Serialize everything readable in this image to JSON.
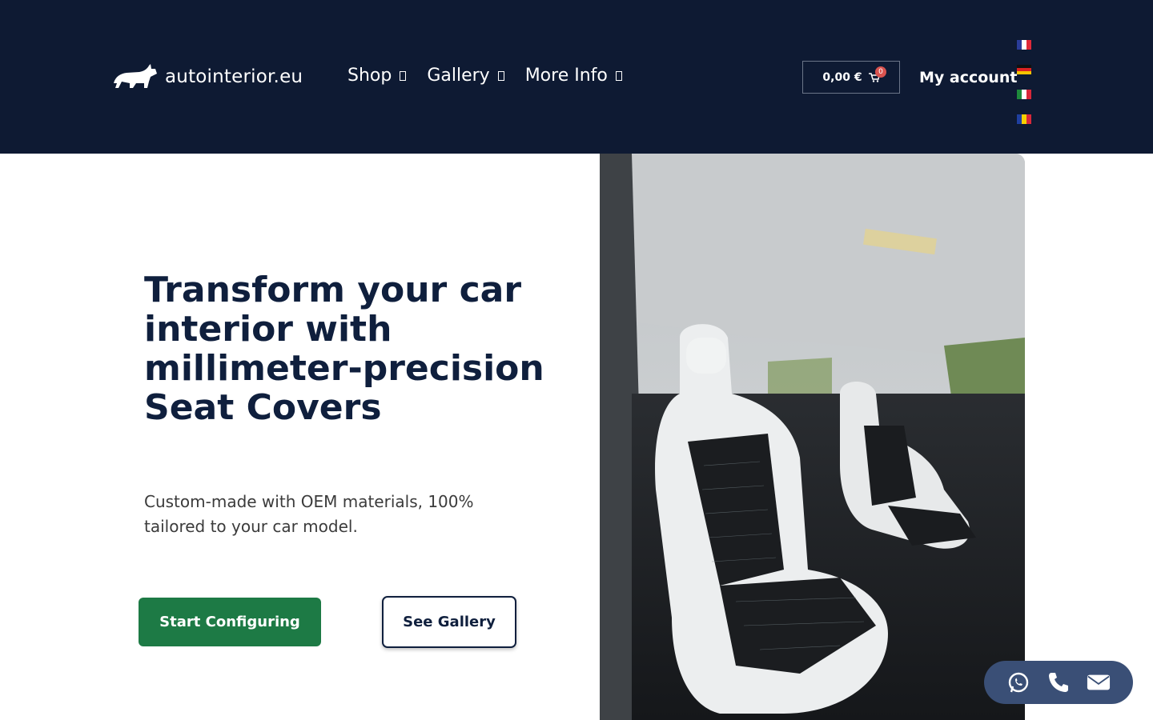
{
  "header": {
    "logo_text": "autointerior.eu",
    "nav": [
      {
        "label": "Shop"
      },
      {
        "label": "Gallery"
      },
      {
        "label": "More Info"
      }
    ],
    "cart": {
      "total": "0,00 €",
      "count": "0"
    },
    "account_label": "My account",
    "languages": [
      "fr",
      "de",
      "it",
      "ro"
    ]
  },
  "hero": {
    "title": "Transform your car interior with millimeter-precision Seat Covers",
    "subtitle": "Custom-made with OEM materials, 100% tailored to your car model.",
    "primary_button": "Start Configuring",
    "secondary_button": "See Gallery"
  },
  "contact_bar": {
    "icons": [
      "whatsapp-icon",
      "phone-icon",
      "email-icon"
    ]
  },
  "colors": {
    "header_bg": "#0e1a33",
    "title": "#0f1f3d",
    "primary_button": "#1d7a45",
    "contact_bar": "#3a4f76"
  }
}
